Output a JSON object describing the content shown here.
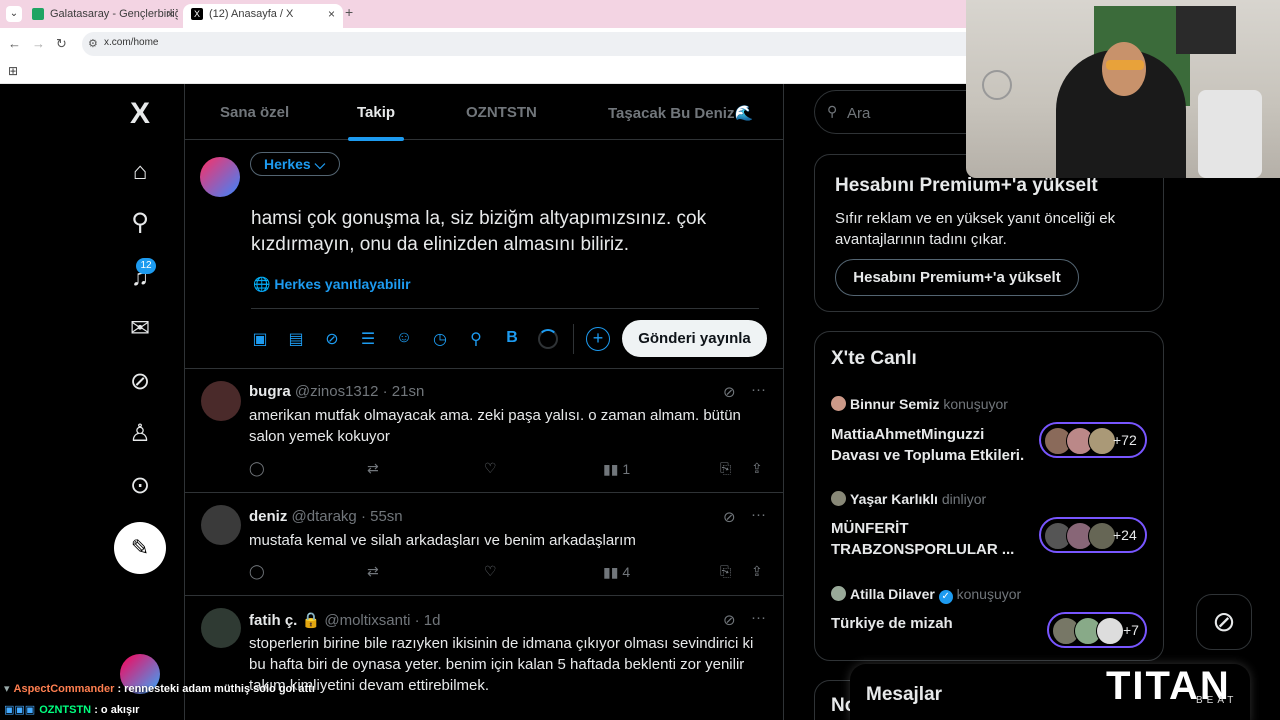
{
  "browser": {
    "tabs": [
      {
        "title": "Galatasaray - Gençlerbirliği canlı",
        "favicon_color": "#1fa463"
      },
      {
        "title": "(12) Anasayfa / X",
        "favicon_color": "#000000"
      }
    ],
    "close_glyph": "×",
    "new_tab_glyph": "+",
    "url": "x.com/home"
  },
  "nav": {
    "notification_badge": "12"
  },
  "feed_tabs": [
    "Sana özel",
    "Takip",
    "OZNTSTN",
    "Taşacak Bu Deniz🌊"
  ],
  "compose": {
    "audience": "Herkes ⌵",
    "text": "hamsi çok gonuşma la, siz biziğm altyapımızsınız. çok kızdırmayın, onu da elinizden almasını biliriz.",
    "reply_setting": "Herkes yanıtlayabilir",
    "reply_icon": "🌐",
    "bold_label": "B",
    "plus": "+",
    "post_button": "Gönderi yayınla"
  },
  "tweets": [
    {
      "name": "bugra",
      "handle": "@zinos1312 · 21sn",
      "text": "amerikan mutfak olmayacak ama. zeki paşa yalısı. o zaman almam. bütün salon yemek kokuyor",
      "views": "1",
      "avatar_color": "#4a2a2a"
    },
    {
      "name": "deniz",
      "handle": "@dtarakg · 55sn",
      "text": "mustafa kemal ve silah arkadaşları ve benim arkadaşlarım",
      "views": "4",
      "avatar_color": "#3a3a3a"
    },
    {
      "name": "fatih ç. 🔒",
      "handle": "@moltixsanti · 1d",
      "text": "stoperlerin birine bile razıyken ikisinin de idmana çıkıyor olması sevindirici ki bu hafta biri de oynasa yeter. benim için kalan 5 haftada beklenti zor yenilir takım kimliyetini devam ettirebilmek.",
      "avatar_color": "#2f3a33"
    }
  ],
  "icons": {
    "more": "···",
    "reply": "◯",
    "retweet": "⇄",
    "like": "♡",
    "views": "▮▮",
    "bookmark": "⎘",
    "share": "⇪",
    "grok": "⊘"
  },
  "right": {
    "search_placeholder": "Ara",
    "premium": {
      "title": "Hesabını Premium+'a yükselt",
      "desc": "Sıfır reklam ve en yüksek yanıt önceliği ek avantajlarının tadını çıkar.",
      "button": "Hesabını Premium+'a yükselt"
    },
    "live": {
      "title": "X'te Canlı",
      "spaces": [
        {
          "host": "Binnur Semiz",
          "role": "konuşuyor",
          "topic": "MattiaAhmetMinguzzi Davası ve Topluma Etkileri.",
          "count": "+72"
        },
        {
          "host": "Yaşar Karlıklı",
          "role": "dinliyor",
          "topic": "MÜNFERİT TRABZONSPORLULAR ...",
          "count": "+24"
        },
        {
          "host": "Atilla Dilaver",
          "role": "konuşuyor",
          "topic": "Türkiye de mizah",
          "count": "+7"
        }
      ]
    },
    "next_card_title": "No",
    "messages_title": "Mesajlar"
  },
  "stream": {
    "chat": [
      {
        "user": "AspectCommander",
        "message": ": rennesteki adam müthiş solo gol attı",
        "user_color": "#ff7f50"
      },
      {
        "user": "OZNTSTN",
        "message": ": o akışır",
        "user_color": "#00ff7f"
      }
    ],
    "logo": "TITAN",
    "logo_sub": "BEAT"
  }
}
